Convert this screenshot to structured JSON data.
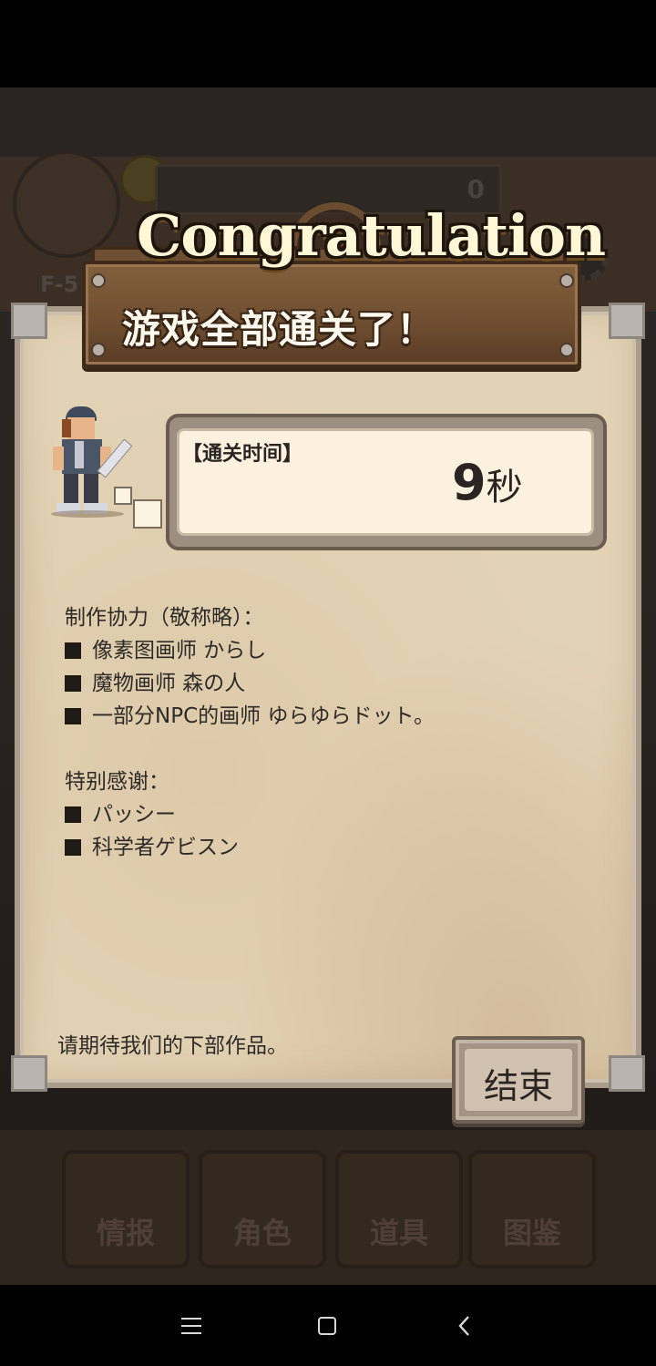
{
  "background": {
    "coin_value": "0",
    "floor_label": "F-5",
    "tabs": [
      {
        "label": "情报",
        "icon": "info-icon"
      },
      {
        "label": "角色",
        "icon": "character-icon"
      },
      {
        "label": "道具",
        "icon": "treasure-chest-icon"
      },
      {
        "label": "图鉴",
        "icon": "book-icon"
      }
    ]
  },
  "dialog": {
    "banner": "Congratulation",
    "title": "游戏全部通关了！",
    "time_label": "【通关时间】",
    "time_value": "9",
    "time_unit": "秒",
    "credits_header": "制作协力（敬称略）：",
    "credits": [
      "像素图画师 からし",
      "魔物画师 森の人",
      "一部分NPC的画师 ゆらゆらドット。"
    ],
    "thanks_header": "特别感谢：",
    "thanks": [
      "パッシー",
      "科学者ゲビスン"
    ],
    "footer_message": "请期待我们的下部作品。",
    "end_button": "结束"
  },
  "colors": {
    "parchment": "#e3d3b5",
    "wood": "#6e4d30",
    "text": "#2e2a27"
  }
}
